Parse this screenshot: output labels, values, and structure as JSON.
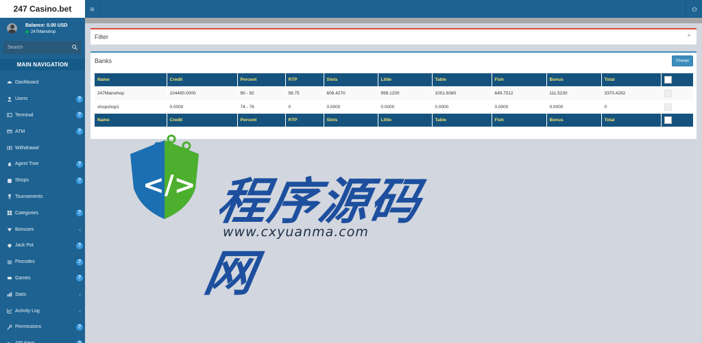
{
  "app": {
    "brand": "247 Casino.bet"
  },
  "user": {
    "balance": "Balance: 0.00 USD",
    "name": "247Mainshop"
  },
  "search": {
    "placeholder": "Search"
  },
  "nav": {
    "header": "MAIN NAVIGATION",
    "items": [
      {
        "label": "Dashboard",
        "icon": "dashboard-icon",
        "badge": ""
      },
      {
        "label": "Users",
        "icon": "users-icon",
        "badge": "?"
      },
      {
        "label": "Terminal",
        "icon": "terminal-icon",
        "badge": "?"
      },
      {
        "label": "ATM",
        "icon": "atm-icon",
        "badge": "?"
      },
      {
        "label": "Withdrawal",
        "icon": "withdrawal-icon",
        "badge": ""
      },
      {
        "label": "Agent Tree",
        "icon": "agent-tree-icon",
        "badge": "?"
      },
      {
        "label": "Shops",
        "icon": "shops-icon",
        "badge": "?"
      },
      {
        "label": "Tournaments",
        "icon": "trophy-icon",
        "badge": ""
      },
      {
        "label": "Categories",
        "icon": "categories-icon",
        "badge": "?"
      },
      {
        "label": "Bonuses",
        "icon": "bonuses-icon",
        "badge": "",
        "chevron": "‹"
      },
      {
        "label": "Jack Pot",
        "icon": "jackpot-icon",
        "badge": "?"
      },
      {
        "label": "Pincodes",
        "icon": "pincodes-icon",
        "badge": "?"
      },
      {
        "label": "Games",
        "icon": "games-icon",
        "badge": "?"
      },
      {
        "label": "Stats",
        "icon": "stats-icon",
        "badge": "",
        "chevron": "‹"
      },
      {
        "label": "Activity Log",
        "icon": "activity-log-icon",
        "badge": "",
        "chevron": "‹"
      },
      {
        "label": "Permissions",
        "icon": "permissions-icon",
        "badge": "?"
      },
      {
        "label": "API Keys",
        "icon": "api-keys-icon",
        "badge": "?"
      }
    ]
  },
  "filter": {
    "title": "Filter",
    "toggle": "+"
  },
  "banks": {
    "title": "Banks",
    "change_label": "Change",
    "columns": [
      "Name",
      "Credit",
      "Percent",
      "RTP",
      "Slots",
      "Little",
      "Table",
      "Fish",
      "Bonus",
      "Total"
    ],
    "rows": [
      [
        "247Mainshop",
        "104490.0000",
        "90 - 92",
        "58.75",
        "608.4270",
        "999.1200",
        "1001.6080",
        "649.7512",
        "111.5230",
        "3370.4292"
      ],
      [
        "shopshop1",
        "0.0000",
        "74 - 76",
        "0",
        "0.0000",
        "0.0000",
        "0.0000",
        "0.0000",
        "0.0000",
        "0"
      ]
    ]
  },
  "watermark": {
    "brand": "程序源码网",
    "url": "www.cxyuanma.com"
  },
  "colors": {
    "sidebar": "#1d6291",
    "table_header": "#15537e",
    "header_text": "#f3e26a",
    "filter_accent": "#dd4b39",
    "banks_accent": "#3c8dbc"
  }
}
